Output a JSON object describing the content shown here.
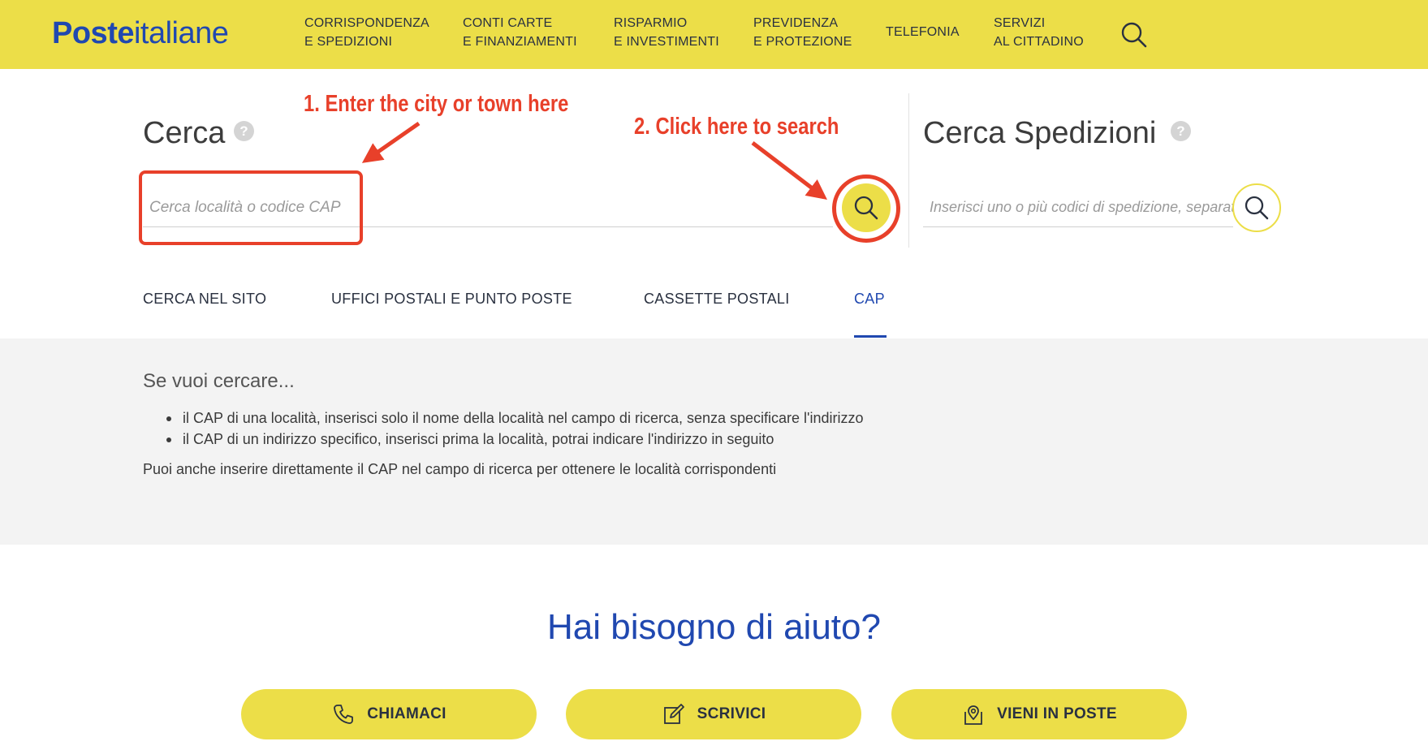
{
  "header": {
    "logo_bold": "Poste",
    "logo_rest": "italiane",
    "nav": [
      {
        "line1": "CORRISPONDENZA",
        "line2": "E SPEDIZIONI"
      },
      {
        "line1": "CONTI CARTE",
        "line2": "E FINANZIAMENTI"
      },
      {
        "line1": "RISPARMIO",
        "line2": "E INVESTIMENTI"
      },
      {
        "line1": "PREVIDENZA",
        "line2": "E PROTEZIONE"
      },
      {
        "line1": "TELEFONIA",
        "line2": ""
      },
      {
        "line1": "SERVIZI",
        "line2": "AL CITTADINO"
      }
    ],
    "search_icon": "search-icon"
  },
  "search": {
    "title": "Cerca",
    "help": "?",
    "placeholder": "Cerca località o codice CAP",
    "value": "",
    "button_icon": "search-icon"
  },
  "spedizioni": {
    "title": "Cerca Spedizioni",
    "help": "?",
    "placeholder": "Inserisci uno o più codici di spedizione, separati da virgola",
    "button_icon": "search-icon"
  },
  "tabs": [
    {
      "label": "CERCA NEL SITO",
      "active": false
    },
    {
      "label": "UFFICI POSTALI E PUNTO POSTE",
      "active": false
    },
    {
      "label": "CASSETTE POSTALI",
      "active": false
    },
    {
      "label": "CAP",
      "active": true
    }
  ],
  "info": {
    "title": "Se vuoi cercare...",
    "bullets": [
      "il CAP di una località, inserisci solo il nome della località nel campo di ricerca, senza specificare l'indirizzo",
      "il CAP di un indirizzo specifico, inserisci prima la località, potrai indicare l'indirizzo in seguito"
    ],
    "note": "Puoi anche inserire direttamente il CAP nel campo di ricerca per ottenere le località corrispondenti"
  },
  "help": {
    "title": "Hai bisogno di aiuto?",
    "buttons": [
      {
        "label": "CHIAMACI",
        "icon": "phone-icon"
      },
      {
        "label": "SCRIVICI",
        "icon": "pencil-icon"
      },
      {
        "label": "VIENI IN POSTE",
        "icon": "location-pin-icon"
      }
    ]
  },
  "annotations": {
    "step1": "1.  Enter the city or town here",
    "step2": "2.  Click here to search"
  },
  "colors": {
    "brand_yellow": "#ecde48",
    "brand_blue": "#2048b0",
    "annotation_red": "#e8402a"
  }
}
